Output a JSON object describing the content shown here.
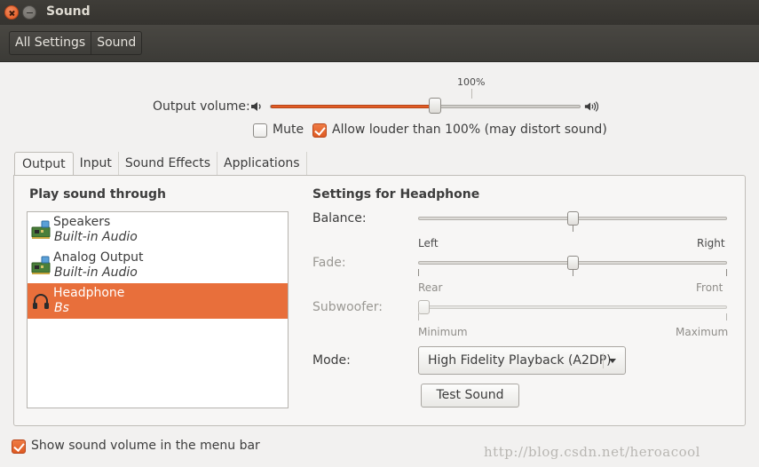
{
  "window": {
    "title": "Sound"
  },
  "toolbar": {
    "breadcrumbs": [
      "All Settings",
      "Sound"
    ]
  },
  "volume": {
    "label": "Output volume:",
    "percent_label": "100%",
    "level": 0.53,
    "mute_label": "Mute",
    "mute_checked": false,
    "allow_louder_label": "Allow louder than 100% (may distort sound)",
    "allow_louder_checked": true
  },
  "tabs": [
    {
      "label": "Output",
      "active": true
    },
    {
      "label": "Input",
      "active": false
    },
    {
      "label": "Sound Effects",
      "active": false
    },
    {
      "label": "Applications",
      "active": false
    }
  ],
  "output": {
    "list_title": "Play sound through",
    "devices": [
      {
        "name": "Speakers",
        "sub": "Built-in Audio",
        "icon": "sound-card-icon",
        "selected": false
      },
      {
        "name": "Analog Output",
        "sub": "Built-in Audio",
        "icon": "sound-card-icon",
        "selected": false
      },
      {
        "name": "Headphone",
        "sub": "Bs",
        "icon": "headphone-icon",
        "selected": true
      }
    ],
    "settings_title": "Settings for Headphone",
    "balance": {
      "label": "Balance:",
      "left": "Left",
      "right": "Right",
      "value": 0.5
    },
    "fade": {
      "label": "Fade:",
      "left": "Rear",
      "right": "Front",
      "value": 0.5
    },
    "subwoofer": {
      "label": "Subwoofer:",
      "left": "Minimum",
      "right": "Maximum",
      "value": 0.0
    },
    "mode": {
      "label": "Mode:",
      "value": "High Fidelity Playback (A2DP)"
    },
    "test_button": "Test Sound"
  },
  "footer": {
    "show_volume_label": "Show sound volume in the menu bar",
    "show_volume_checked": true
  },
  "watermark": "http://blog.csdn.net/heroacool",
  "colors": {
    "accent": "#e35c25",
    "selection": "#e86f3b",
    "titlebar": "#3c3b37"
  }
}
